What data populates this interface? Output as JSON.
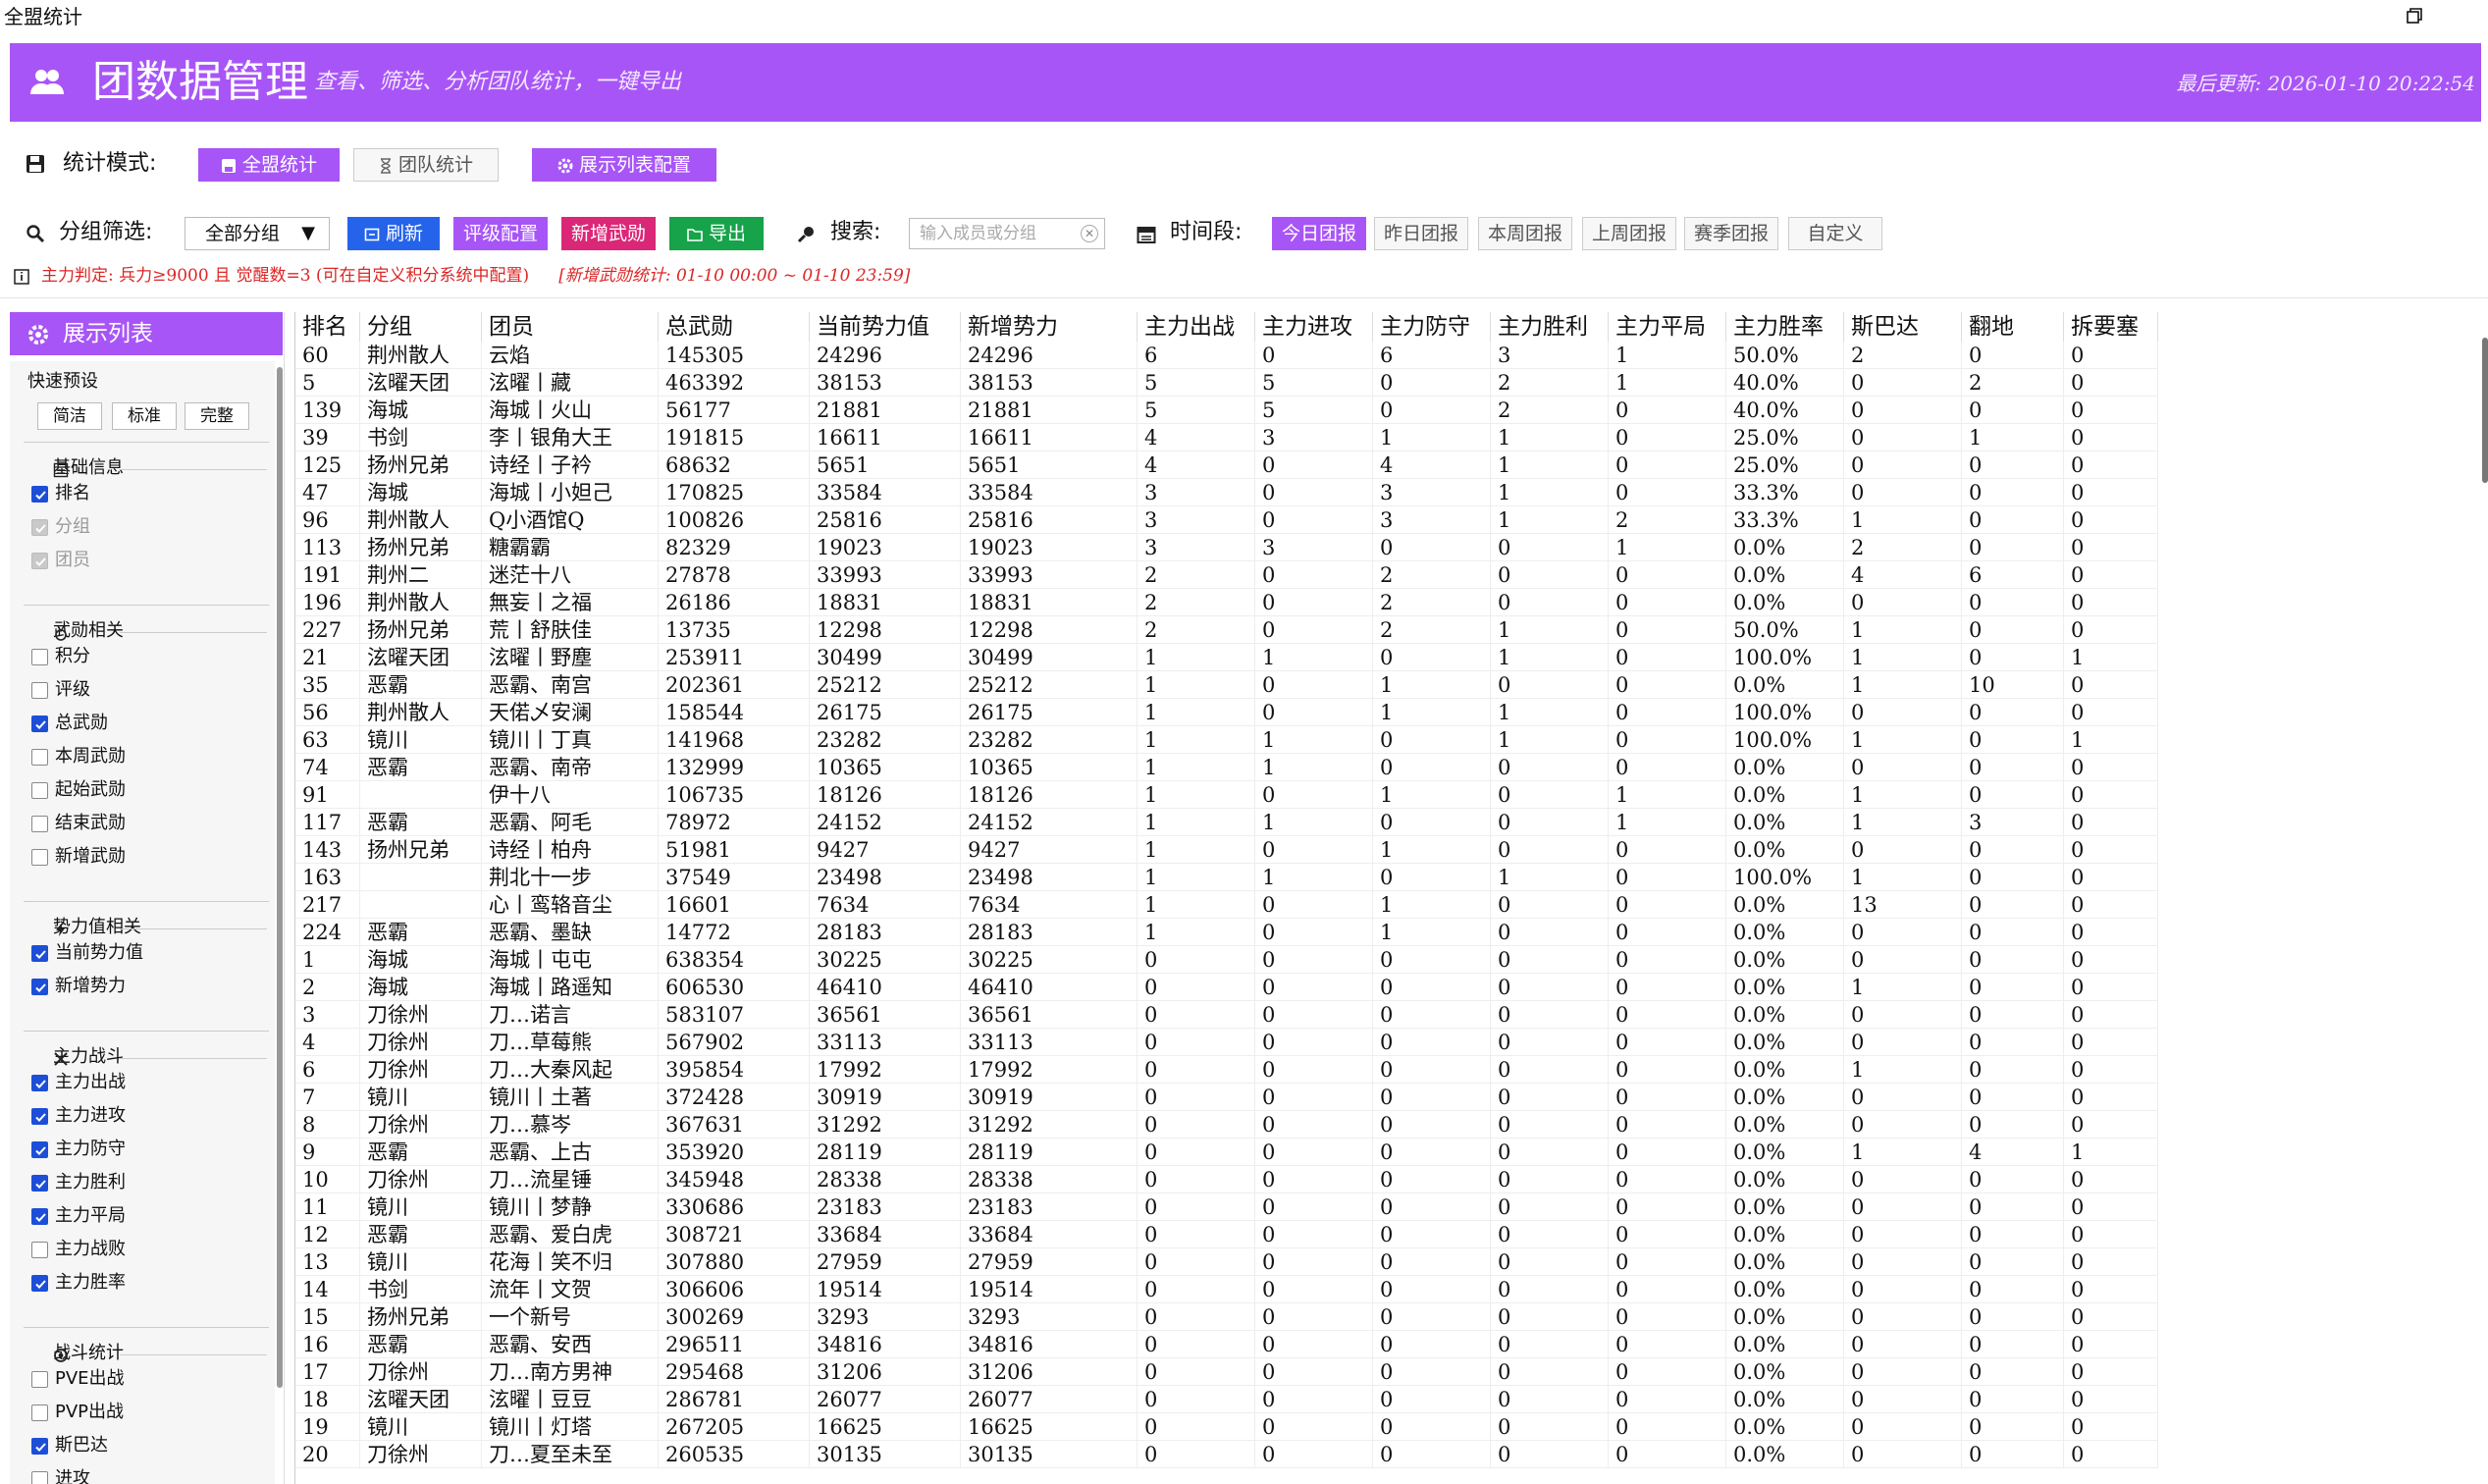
{
  "window": {
    "title": "全盟统计",
    "restore_icon": "restore-window-icon"
  },
  "header": {
    "title": "团数据管理",
    "subtitle": "查看、筛选、分析团队统计，一键导出",
    "last_update": "最后更新: 2026-01-10 20:22:54",
    "accent": "#a855f7"
  },
  "mode_bar": {
    "label": "统计模式:",
    "buttons": [
      "全盟统计",
      "团队统计",
      "展示列表配置"
    ]
  },
  "filter_bar": {
    "group_label": "分组筛选:",
    "group_value": "全部分组",
    "refresh": "刷新",
    "rating_config": "评级配置",
    "add_wuxun": "新增武勋",
    "export": "导出",
    "search_label": "搜索:",
    "search_placeholder": "输入成员或分组",
    "period_label": "时间段:",
    "periods": [
      "今日团报",
      "昨日团报",
      "本周团报",
      "上周团报",
      "赛季团报",
      "自定义"
    ]
  },
  "note": {
    "main": "主力判定: 兵力≥9000 且 觉醒数=3 (可在自定义积分系统中配置)",
    "range": "[新增武勋统计: 01-10 00:00 ~ 01-10 23:59]"
  },
  "side": {
    "title": "展示列表",
    "preset_label": "快速预设",
    "presets": [
      "简洁",
      "标准",
      "完整"
    ],
    "groups": [
      {
        "title": "基础信息",
        "items": [
          {
            "label": "排名",
            "state": "on"
          },
          {
            "label": "分组",
            "state": "dis"
          },
          {
            "label": "团员",
            "state": "dis"
          }
        ]
      },
      {
        "title": "武勋相关",
        "items": [
          {
            "label": "积分",
            "state": "off"
          },
          {
            "label": "评级",
            "state": "off"
          },
          {
            "label": "总武勋",
            "state": "on"
          },
          {
            "label": "本周武勋",
            "state": "off"
          },
          {
            "label": "起始武勋",
            "state": "off"
          },
          {
            "label": "结束武勋",
            "state": "off"
          },
          {
            "label": "新增武勋",
            "state": "off"
          }
        ]
      },
      {
        "title": "势力值相关",
        "items": [
          {
            "label": "当前势力值",
            "state": "on"
          },
          {
            "label": "新增势力",
            "state": "on"
          }
        ]
      },
      {
        "title": "主力战斗",
        "items": [
          {
            "label": "主力出战",
            "state": "on"
          },
          {
            "label": "主力进攻",
            "state": "on"
          },
          {
            "label": "主力防守",
            "state": "on"
          },
          {
            "label": "主力胜利",
            "state": "on"
          },
          {
            "label": "主力平局",
            "state": "on"
          },
          {
            "label": "主力战败",
            "state": "off"
          },
          {
            "label": "主力胜率",
            "state": "on"
          }
        ]
      },
      {
        "title": "战斗统计",
        "items": [
          {
            "label": "PVE出战",
            "state": "off"
          },
          {
            "label": "PVP出战",
            "state": "off"
          },
          {
            "label": "斯巴达",
            "state": "on"
          },
          {
            "label": "进攻",
            "state": "off"
          }
        ]
      }
    ]
  },
  "table": {
    "columns": [
      "排名",
      "分组",
      "团员",
      "总武勋",
      "当前势力值",
      "新增势力",
      "主力出战",
      "主力进攻",
      "主力防守",
      "主力胜利",
      "主力平局",
      "主力胜率",
      "斯巴达",
      "翻地",
      "拆要塞"
    ],
    "rows": [
      [
        "60",
        "荆州散人",
        "云焰",
        "145305",
        "24296",
        "24296",
        "6",
        "0",
        "6",
        "3",
        "1",
        "50.0%",
        "2",
        "0",
        "0"
      ],
      [
        "5",
        "泫曜天团",
        "泫曜丨藏",
        "463392",
        "38153",
        "38153",
        "5",
        "5",
        "0",
        "2",
        "1",
        "40.0%",
        "0",
        "2",
        "0"
      ],
      [
        "139",
        "海城",
        "海城丨火山",
        "56177",
        "21881",
        "21881",
        "5",
        "5",
        "0",
        "2",
        "0",
        "40.0%",
        "0",
        "0",
        "0"
      ],
      [
        "39",
        "书剑",
        "李丨银角大王",
        "191815",
        "16611",
        "16611",
        "4",
        "3",
        "1",
        "1",
        "0",
        "25.0%",
        "0",
        "1",
        "0"
      ],
      [
        "125",
        "扬州兄弟",
        "诗经丨子衿",
        "68632",
        "5651",
        "5651",
        "4",
        "0",
        "4",
        "1",
        "0",
        "25.0%",
        "0",
        "0",
        "0"
      ],
      [
        "47",
        "海城",
        "海城丨小妲己",
        "170825",
        "33584",
        "33584",
        "3",
        "0",
        "3",
        "1",
        "0",
        "33.3%",
        "0",
        "0",
        "0"
      ],
      [
        "96",
        "荆州散人",
        "Q小酒馆Q",
        "100826",
        "25816",
        "25816",
        "3",
        "0",
        "3",
        "1",
        "2",
        "33.3%",
        "1",
        "0",
        "0"
      ],
      [
        "113",
        "扬州兄弟",
        "糖霸霸",
        "82329",
        "19023",
        "19023",
        "3",
        "3",
        "0",
        "0",
        "1",
        "0.0%",
        "2",
        "0",
        "0"
      ],
      [
        "191",
        "荆州二",
        "迷茫十八",
        "27878",
        "33993",
        "33993",
        "2",
        "0",
        "2",
        "0",
        "0",
        "0.0%",
        "4",
        "6",
        "0"
      ],
      [
        "196",
        "荆州散人",
        "無妄丨之福",
        "26186",
        "18831",
        "18831",
        "2",
        "0",
        "2",
        "0",
        "0",
        "0.0%",
        "0",
        "0",
        "0"
      ],
      [
        "227",
        "扬州兄弟",
        "荒丨舒肤佳",
        "13735",
        "12298",
        "12298",
        "2",
        "0",
        "2",
        "1",
        "0",
        "50.0%",
        "1",
        "0",
        "0"
      ],
      [
        "21",
        "泫曜天团",
        "泫曜丨野塵",
        "253911",
        "30499",
        "30499",
        "1",
        "1",
        "0",
        "1",
        "0",
        "100.0%",
        "1",
        "0",
        "1"
      ],
      [
        "35",
        "恶霸",
        "恶霸、南宫",
        "202361",
        "25212",
        "25212",
        "1",
        "0",
        "1",
        "0",
        "0",
        "0.0%",
        "1",
        "10",
        "0"
      ],
      [
        "56",
        "荆州散人",
        "天偌乄安澜",
        "158544",
        "26175",
        "26175",
        "1",
        "0",
        "1",
        "1",
        "0",
        "100.0%",
        "0",
        "0",
        "0"
      ],
      [
        "63",
        "镜川",
        "镜川丨丁真",
        "141968",
        "23282",
        "23282",
        "1",
        "1",
        "0",
        "1",
        "0",
        "100.0%",
        "1",
        "0",
        "1"
      ],
      [
        "74",
        "恶霸",
        "恶霸、南帝",
        "132999",
        "10365",
        "10365",
        "1",
        "1",
        "0",
        "0",
        "0",
        "0.0%",
        "0",
        "0",
        "0"
      ],
      [
        "91",
        "",
        "伊十八",
        "106735",
        "18126",
        "18126",
        "1",
        "0",
        "1",
        "0",
        "1",
        "0.0%",
        "1",
        "0",
        "0"
      ],
      [
        "117",
        "恶霸",
        "恶霸、阿毛",
        "78972",
        "24152",
        "24152",
        "1",
        "1",
        "0",
        "0",
        "1",
        "0.0%",
        "1",
        "3",
        "0"
      ],
      [
        "143",
        "扬州兄弟",
        "诗经丨柏舟",
        "51981",
        "9427",
        "9427",
        "1",
        "0",
        "1",
        "0",
        "0",
        "0.0%",
        "0",
        "0",
        "0"
      ],
      [
        "163",
        "",
        "荆北十一步",
        "37549",
        "23498",
        "23498",
        "1",
        "1",
        "0",
        "1",
        "0",
        "100.0%",
        "1",
        "0",
        "0"
      ],
      [
        "217",
        "",
        "心丨鸾辂音尘",
        "16601",
        "7634",
        "7634",
        "1",
        "0",
        "1",
        "0",
        "0",
        "0.0%",
        "13",
        "0",
        "0"
      ],
      [
        "224",
        "恶霸",
        "恶霸、墨缺",
        "14772",
        "28183",
        "28183",
        "1",
        "0",
        "1",
        "0",
        "0",
        "0.0%",
        "0",
        "0",
        "0"
      ],
      [
        "1",
        "海城",
        "海城丨屯屯",
        "638354",
        "30225",
        "30225",
        "0",
        "0",
        "0",
        "0",
        "0",
        "0.0%",
        "0",
        "0",
        "0"
      ],
      [
        "2",
        "海城",
        "海城丨路遥知",
        "606530",
        "46410",
        "46410",
        "0",
        "0",
        "0",
        "0",
        "0",
        "0.0%",
        "1",
        "0",
        "0"
      ],
      [
        "3",
        "刀徐州",
        "刀…诺言",
        "583107",
        "36561",
        "36561",
        "0",
        "0",
        "0",
        "0",
        "0",
        "0.0%",
        "0",
        "0",
        "0"
      ],
      [
        "4",
        "刀徐州",
        "刀…草莓熊",
        "567902",
        "33113",
        "33113",
        "0",
        "0",
        "0",
        "0",
        "0",
        "0.0%",
        "0",
        "0",
        "0"
      ],
      [
        "6",
        "刀徐州",
        "刀…大秦风起",
        "395854",
        "17992",
        "17992",
        "0",
        "0",
        "0",
        "0",
        "0",
        "0.0%",
        "1",
        "0",
        "0"
      ],
      [
        "7",
        "镜川",
        "镜川丨土著",
        "372428",
        "30919",
        "30919",
        "0",
        "0",
        "0",
        "0",
        "0",
        "0.0%",
        "0",
        "0",
        "0"
      ],
      [
        "8",
        "刀徐州",
        "刀…慕岑",
        "367631",
        "31292",
        "31292",
        "0",
        "0",
        "0",
        "0",
        "0",
        "0.0%",
        "0",
        "0",
        "0"
      ],
      [
        "9",
        "恶霸",
        "恶霸、上古",
        "353920",
        "28119",
        "28119",
        "0",
        "0",
        "0",
        "0",
        "0",
        "0.0%",
        "1",
        "4",
        "1"
      ],
      [
        "10",
        "刀徐州",
        "刀…流星锤",
        "345948",
        "28338",
        "28338",
        "0",
        "0",
        "0",
        "0",
        "0",
        "0.0%",
        "0",
        "0",
        "0"
      ],
      [
        "11",
        "镜川",
        "镜川丨梦静",
        "330686",
        "23183",
        "23183",
        "0",
        "0",
        "0",
        "0",
        "0",
        "0.0%",
        "0",
        "0",
        "0"
      ],
      [
        "12",
        "恶霸",
        "恶霸、爱白虎",
        "308721",
        "33684",
        "33684",
        "0",
        "0",
        "0",
        "0",
        "0",
        "0.0%",
        "0",
        "0",
        "0"
      ],
      [
        "13",
        "镜川",
        "花海丨笑不归",
        "307880",
        "27959",
        "27959",
        "0",
        "0",
        "0",
        "0",
        "0",
        "0.0%",
        "0",
        "0",
        "0"
      ],
      [
        "14",
        "书剑",
        "流年丨文贺",
        "306606",
        "19514",
        "19514",
        "0",
        "0",
        "0",
        "0",
        "0",
        "0.0%",
        "0",
        "0",
        "0"
      ],
      [
        "15",
        "扬州兄弟",
        "一个新号",
        "300269",
        "3293",
        "3293",
        "0",
        "0",
        "0",
        "0",
        "0",
        "0.0%",
        "0",
        "0",
        "0"
      ],
      [
        "16",
        "恶霸",
        "恶霸、安西",
        "296511",
        "34816",
        "34816",
        "0",
        "0",
        "0",
        "0",
        "0",
        "0.0%",
        "0",
        "0",
        "0"
      ],
      [
        "17",
        "刀徐州",
        "刀…南方男神",
        "295468",
        "31206",
        "31206",
        "0",
        "0",
        "0",
        "0",
        "0",
        "0.0%",
        "0",
        "0",
        "0"
      ],
      [
        "18",
        "泫曜天团",
        "泫曜丨豆豆",
        "286781",
        "26077",
        "26077",
        "0",
        "0",
        "0",
        "0",
        "0",
        "0.0%",
        "0",
        "0",
        "0"
      ],
      [
        "19",
        "镜川",
        "镜川丨灯塔",
        "267205",
        "16625",
        "16625",
        "0",
        "0",
        "0",
        "0",
        "0",
        "0.0%",
        "0",
        "0",
        "0"
      ],
      [
        "20",
        "刀徐州",
        "刀…夏至未至",
        "260535",
        "30135",
        "30135",
        "0",
        "0",
        "0",
        "0",
        "0",
        "0.0%",
        "0",
        "0",
        "0"
      ]
    ]
  }
}
